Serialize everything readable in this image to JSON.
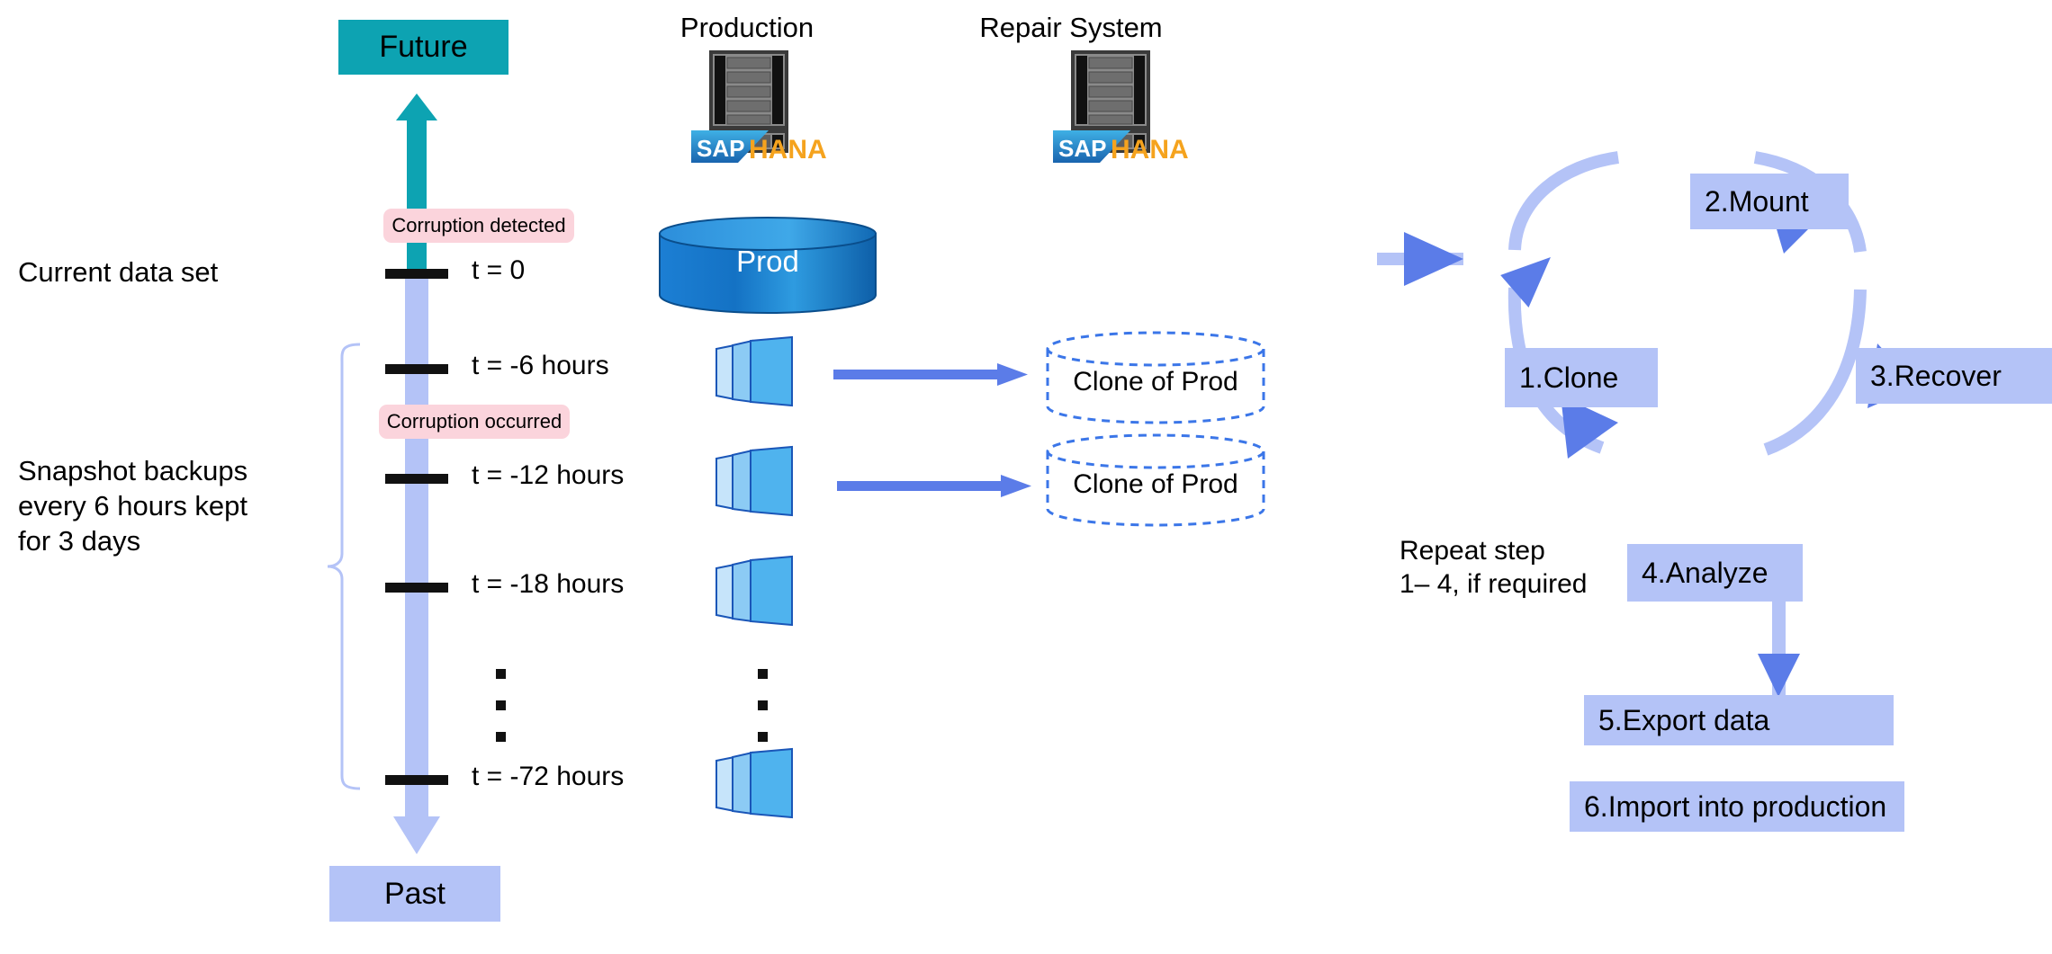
{
  "timeline": {
    "future_label": "Future",
    "past_label": "Past",
    "current_note": "Current data set",
    "retention_note": "Snapshot backups\nevery 6 hours kept\nfor 3 days",
    "events": [
      {
        "name": "corruption-detected",
        "label": "Corruption detected",
        "color": "#FBD4DC"
      },
      {
        "name": "corruption-occurred",
        "label": "Corruption occurred",
        "color": "#FBD4DC"
      }
    ],
    "ticks": [
      {
        "label": "t = 0"
      },
      {
        "label": "t = -6 hours"
      },
      {
        "label": "t = -12 hours"
      },
      {
        "label": "t = -18 hours"
      },
      {
        "label": "t = -72 hours"
      }
    ],
    "ellipsis": "⋮"
  },
  "systems": {
    "production": {
      "title": "Production",
      "logo": "SAP HANA",
      "logo_sap": "SAP",
      "logo_hana": "HANA"
    },
    "repair": {
      "title": "Repair System",
      "logo": "SAP HANA",
      "logo_sap": "SAP",
      "logo_hana": "HANA"
    }
  },
  "storage": {
    "prod_db": "Prod",
    "clones": [
      "Clone of Prod",
      "Clone of Prod"
    ]
  },
  "process": {
    "steps": [
      {
        "num": "1",
        "label": "1.Clone"
      },
      {
        "num": "2",
        "label": "2.Mount"
      },
      {
        "num": "3",
        "label": "3.Recover"
      },
      {
        "num": "4",
        "label": "4.Analyze"
      },
      {
        "num": "5",
        "label": "5.Export data"
      },
      {
        "num": "6",
        "label": "6.Import into production"
      }
    ],
    "repeat_note": "Repeat step\n1– 4, if required"
  },
  "colors": {
    "teal": "#0DA3B2",
    "periwinkle": "#B4C3F7",
    "arrow_blue": "#5B7CE8",
    "pink": "#FBD4DC",
    "prod_blue": "#0F6FC6",
    "snap_blue": "#4FB3EE",
    "clone_dash": "#3B76E8"
  }
}
